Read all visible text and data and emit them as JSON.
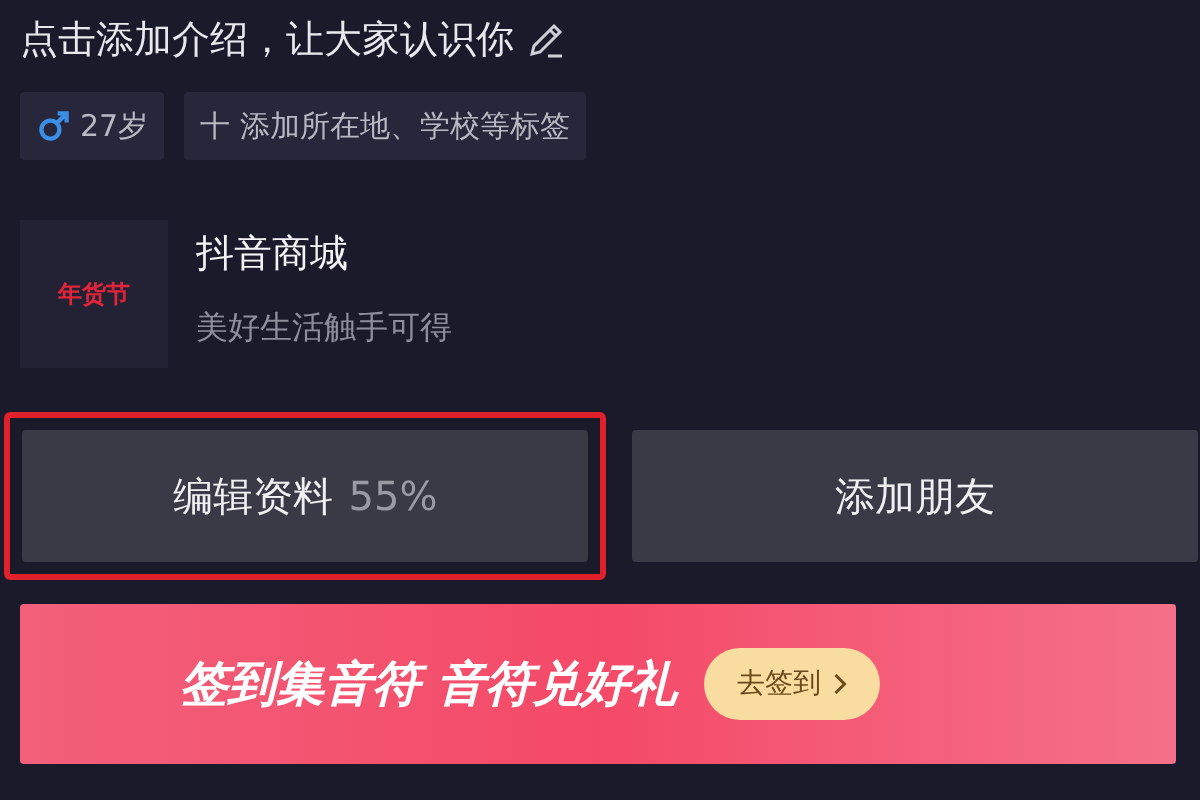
{
  "intro": {
    "text": "点击添加介绍，让大家认识你"
  },
  "tags": [
    {
      "kind": "gender",
      "label": "27岁"
    },
    {
      "kind": "add",
      "label": "十 添加所在地、学校等标签"
    }
  ],
  "store": {
    "logo_text": "年货节",
    "name": "抖音商城",
    "slogan": "美好生活触手可得"
  },
  "buttons": [
    {
      "label": "编辑资料",
      "progress": "55%",
      "highlighted": true
    },
    {
      "label": "添加朋友",
      "highlighted": false
    }
  ],
  "banner": {
    "title": "签到集音符 音符兑好礼",
    "action": "去签到"
  }
}
